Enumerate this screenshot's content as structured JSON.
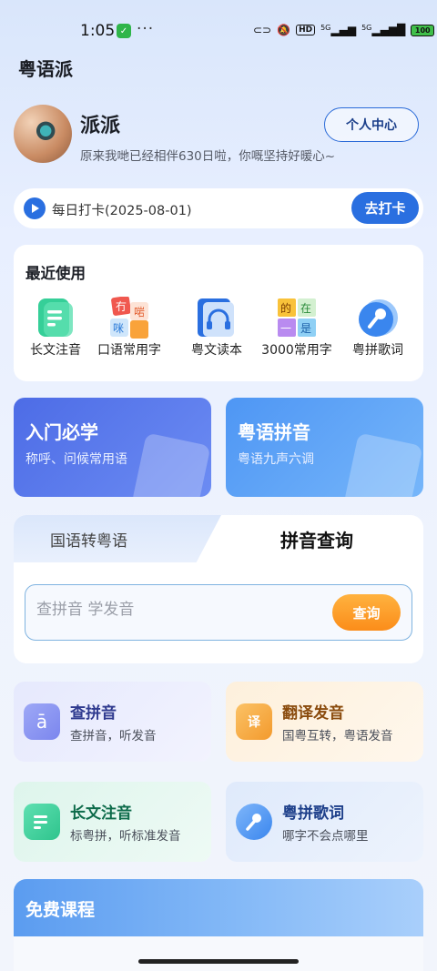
{
  "status_bar": {
    "time": "1:05",
    "dots": "···",
    "hd": "HD",
    "net1": "5G",
    "net2": "5G",
    "battery": "100"
  },
  "app": {
    "title": "粤语派"
  },
  "profile": {
    "name": "派派",
    "bio": "原来我哋已经相伴630日啦，你嘅坚持好暖心~",
    "center_button": "个人中心"
  },
  "checkin": {
    "text": "每日打卡(2025-08-01)",
    "button": "去打卡"
  },
  "recent": {
    "title": "最近使用",
    "items": [
      {
        "label": "长文注音",
        "icon": "document-icon"
      },
      {
        "label": "口语常用字",
        "icon": "characters-icon"
      },
      {
        "label": "粤文读本",
        "icon": "audiobook-icon"
      },
      {
        "label": "3000常用字",
        "icon": "grid-characters-icon"
      },
      {
        "label": "粤拼歌词",
        "icon": "microphone-icon"
      }
    ]
  },
  "features": [
    {
      "title": "入门必学",
      "subtitle": "称呼、问候常用语"
    },
    {
      "title": "粤语拼音",
      "subtitle": "粤语九声六调"
    }
  ],
  "query": {
    "tab_translate": "国语转粤语",
    "tab_pinyin": "拼音查询",
    "placeholder": "查拼音 学发音",
    "button": "查询"
  },
  "functions": [
    {
      "title": "查拼音",
      "subtitle": "查拼音，听发音",
      "icon": "pinyin-icon",
      "icon_glyph": "ā",
      "color": "#2f3a8f"
    },
    {
      "title": "翻译发音",
      "subtitle": "国粤互转，粤语发音",
      "icon": "translate-icon",
      "icon_glyph": "译",
      "color": "#8a4b0d"
    },
    {
      "title": "长文注音",
      "subtitle": "标粤拼，听标准发音",
      "icon": "document-icon",
      "icon_glyph": "",
      "color": "#0d6b4a"
    },
    {
      "title": "粤拼歌词",
      "subtitle": "哪字不会点哪里",
      "icon": "microphone-icon",
      "icon_glyph": "",
      "color": "#1d3f8a"
    }
  ],
  "free_courses": {
    "title": "免费课程"
  },
  "colors": {
    "primary": "#2a6fe0",
    "orange": "#fb8d1a"
  }
}
